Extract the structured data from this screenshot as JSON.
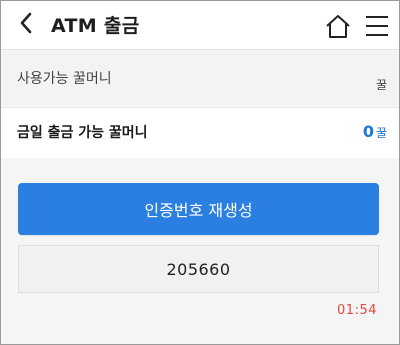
{
  "header": {
    "title": "ATM 출금",
    "back_icon": "chevron-left-icon",
    "home_icon": "home-icon",
    "menu_icon": "hamburger-menu-icon"
  },
  "available": {
    "label": "사용가능 꿀머니",
    "unit": "꿀"
  },
  "today": {
    "label": "금일 출금 가능 꿀머니",
    "amount": "0",
    "unit": "꿀"
  },
  "actions": {
    "regenerate_label": "인증번호 재생성"
  },
  "auth": {
    "code": "205660",
    "timer": "01:54"
  },
  "colors": {
    "accent": "#2a7fe0",
    "amount": "#1d78d6",
    "timer": "#e04a3c"
  }
}
